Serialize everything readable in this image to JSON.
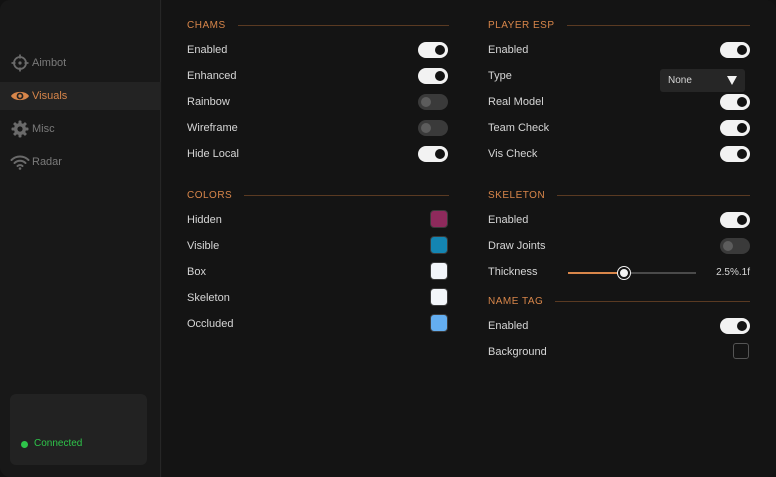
{
  "sidebar": {
    "items": [
      {
        "label": "Aimbot",
        "icon": "crosshair-icon"
      },
      {
        "label": "Visuals",
        "icon": "eye-icon"
      },
      {
        "label": "Misc",
        "icon": "gear-icon"
      },
      {
        "label": "Radar",
        "icon": "wifi-icon"
      }
    ],
    "active_index": 1,
    "status": {
      "text": "Connected",
      "color": "#2ec44a"
    }
  },
  "colors": {
    "accent": "#d8864a",
    "toggle_on": "#f2f2f2",
    "toggle_off": "#3a3a3a"
  },
  "chams": {
    "title": "CHAMS",
    "rows": [
      {
        "label": "Enabled",
        "on": true
      },
      {
        "label": "Enhanced",
        "on": true
      },
      {
        "label": "Rainbow",
        "on": false
      },
      {
        "label": "Wireframe",
        "on": false
      },
      {
        "label": "Hide Local",
        "on": true
      }
    ]
  },
  "color_settings": {
    "title": "COLORS",
    "rows": [
      {
        "label": "Hidden",
        "color": "#8e2a5c"
      },
      {
        "label": "Visible",
        "color": "#1485b2"
      },
      {
        "label": "Box",
        "color": "#f3f6fa"
      },
      {
        "label": "Skeleton",
        "color": "#f3f6fa"
      },
      {
        "label": "Occluded",
        "color": "#64aef0"
      }
    ]
  },
  "player_esp": {
    "title": "PLAYER ESP",
    "enabled": {
      "label": "Enabled",
      "on": true
    },
    "type": {
      "label": "Type",
      "value": "None"
    },
    "real_model": {
      "label": "Real Model",
      "on": true
    },
    "team_check": {
      "label": "Team Check",
      "on": true
    },
    "vis_check": {
      "label": "Vis Check",
      "on": true
    }
  },
  "skeleton": {
    "title": "SKELETON",
    "enabled": {
      "label": "Enabled",
      "on": true
    },
    "draw_joints": {
      "label": "Draw Joints",
      "on": false
    },
    "thickness": {
      "label": "Thickness",
      "value_text": "2.5%.1f",
      "fraction": 0.44
    }
  },
  "name_tag": {
    "title": "NAME TAG",
    "enabled": {
      "label": "Enabled",
      "on": true
    },
    "background": {
      "label": "Background",
      "checked": false
    }
  }
}
